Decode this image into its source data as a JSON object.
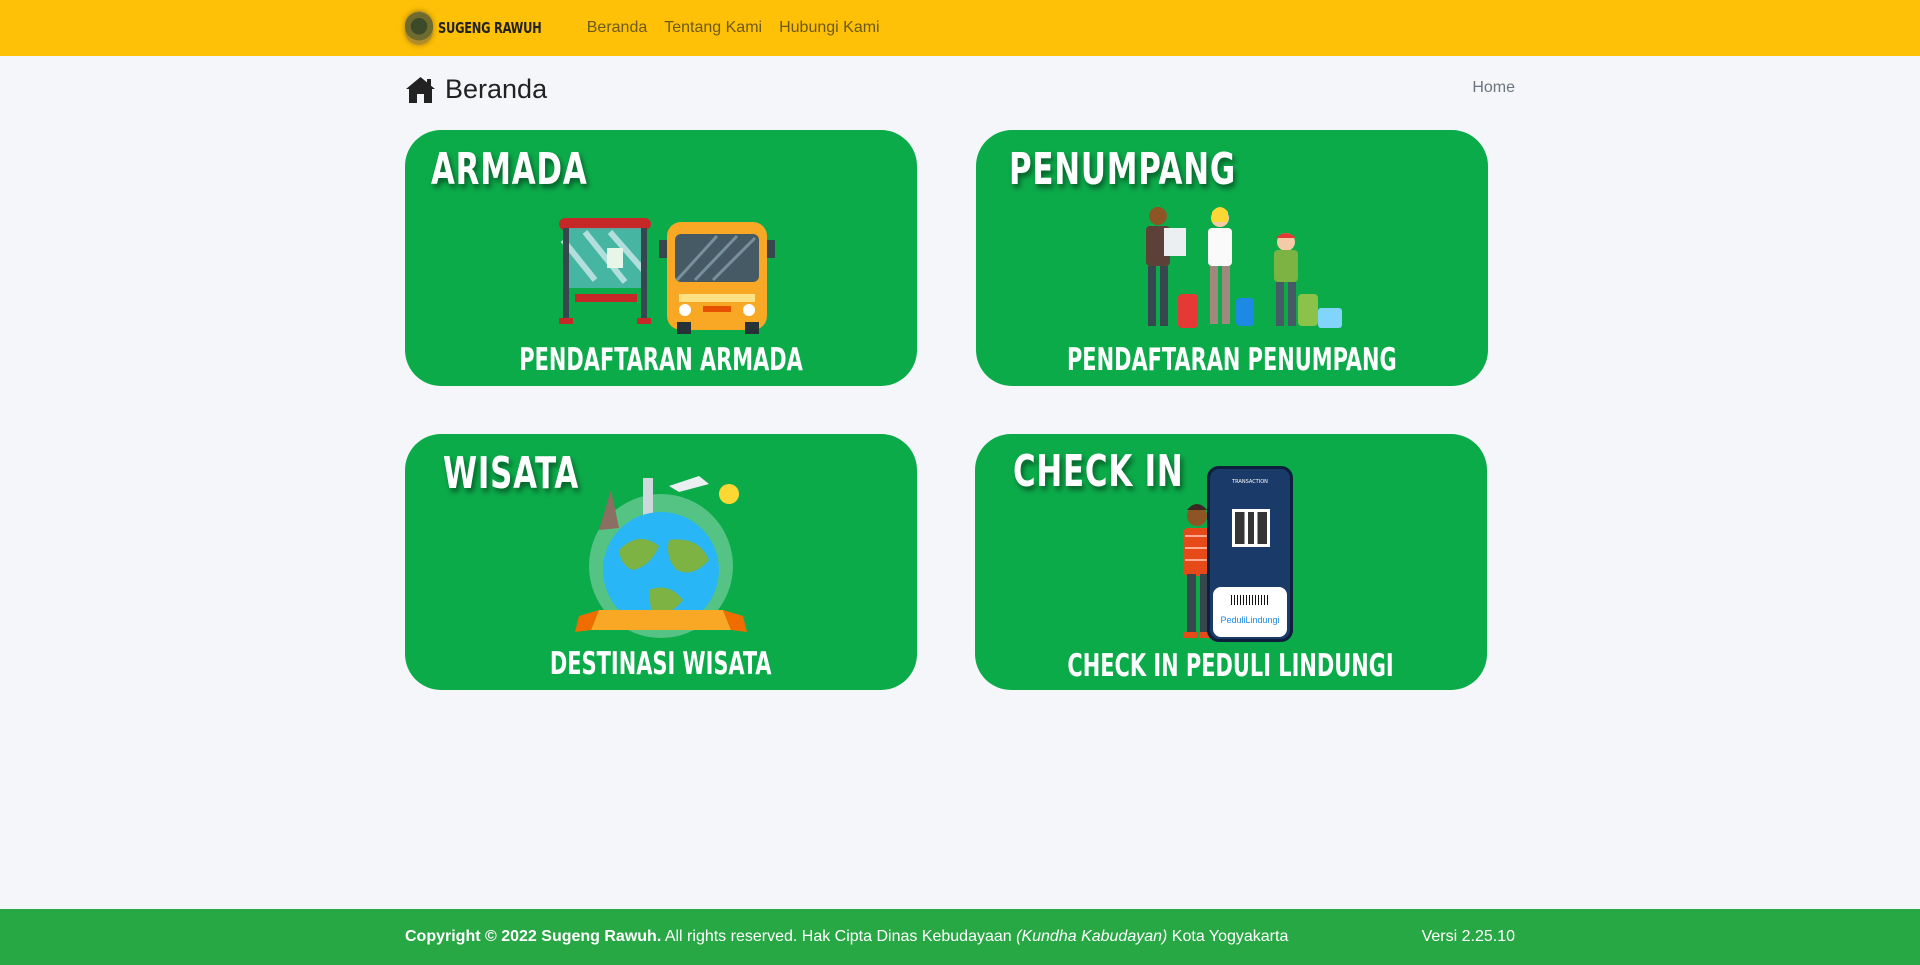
{
  "navbar": {
    "brand": "SUGENG RAWUH",
    "links": [
      "Beranda",
      "Tentang Kami",
      "Hubungi Kami"
    ]
  },
  "header": {
    "title": "Beranda",
    "breadcrumb": "Home"
  },
  "cards": [
    {
      "title": "ARMADA",
      "caption": "PENDAFTARAN ARMADA"
    },
    {
      "title": "PENUMPANG",
      "caption": "PENDAFTARAN PENUMPANG"
    },
    {
      "title": "WISATA",
      "caption": "DESTINASI WISATA"
    },
    {
      "title": "CHECK IN",
      "caption": "CHECK IN PEDULI LINDUNGI"
    }
  ],
  "phone": {
    "screen_title": "TRANSACTION",
    "app_name": "PeduliLindungi"
  },
  "footer": {
    "copyright": "Copyright © 2022 Sugeng Rawuh.",
    "rights": " All rights reserved. Hak Cipta Dinas Kebudayaan ",
    "kundha": "(Kundha Kabudayan)",
    "city": " Kota Yogyakarta",
    "version": "Versi 2.25.10"
  },
  "colors": {
    "navbar": "#ffc107",
    "card": "#0cab4a",
    "footer": "#28a745",
    "background": "#f4f6f9"
  },
  "icons": [
    "logo-icon",
    "home-icon"
  ]
}
